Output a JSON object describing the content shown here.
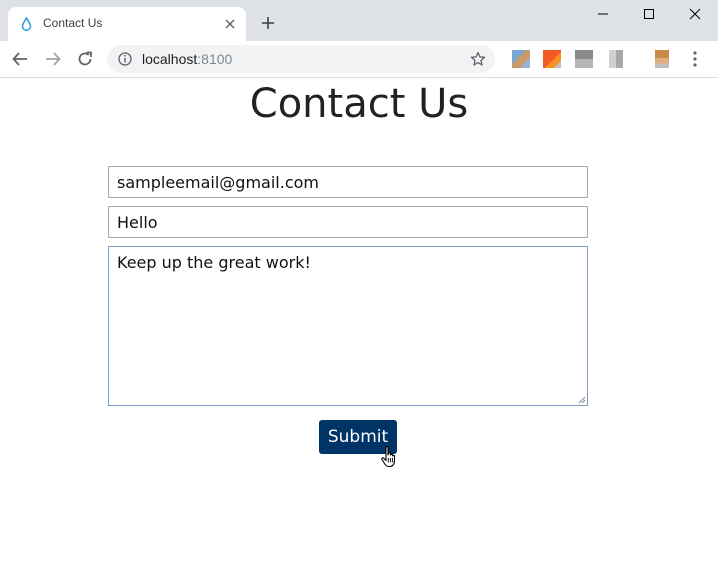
{
  "browser": {
    "tab_title": "Contact Us",
    "url_host": "localhost",
    "url_port": ":8100",
    "icons": [
      "droplet-favicon",
      "close-icon",
      "plus-icon",
      "minimize-icon",
      "maximize-icon",
      "window-close-icon",
      "back-arrow-icon",
      "forward-arrow-icon",
      "reload-icon",
      "info-icon",
      "star-icon",
      "more-vert-icon"
    ]
  },
  "page": {
    "title": "Contact Us",
    "form": {
      "email_value": "sampleemail@gmail.com",
      "subject_value": "Hello",
      "message_value": "Keep up the great work!",
      "submit_label": "Submit"
    }
  },
  "colors": {
    "submit_bg": "#003366",
    "focus_border": "#7a9cc8",
    "tabstrip_bg": "#dee1e6"
  }
}
